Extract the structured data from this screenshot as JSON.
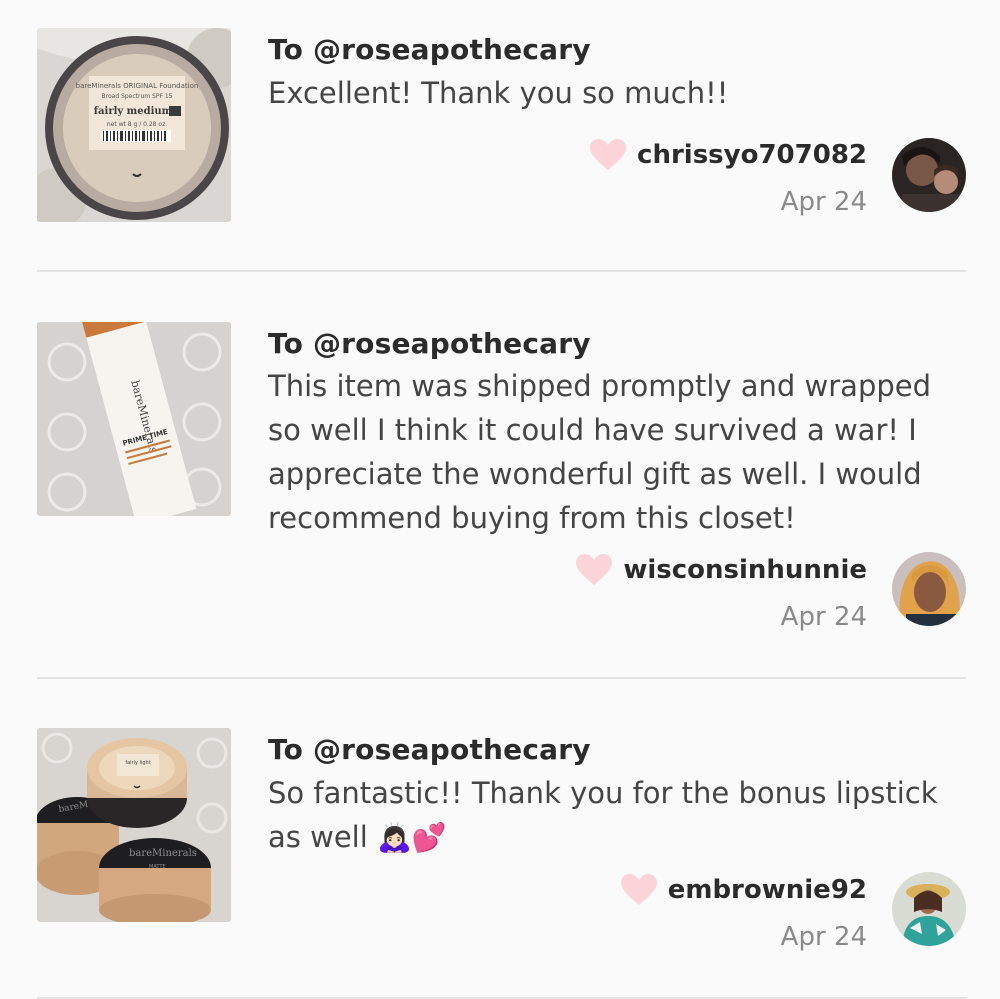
{
  "reviews": [
    {
      "recipient": "To @roseapothecary",
      "comment": "Excellent! Thank you so much!!",
      "username": "chrissyo707082",
      "date": "Apr 24",
      "thumb_label": "bareMinerals ORIGINAL Foundation Broad Spectrum SPF 15 fairly medium C20 net wt 8 g / 0.28 oz.",
      "thumb_brand": "bareMinerals",
      "thumb_shade": "fairly medium"
    },
    {
      "recipient": "To @roseapothecary",
      "comment": "This item was shipped promptly and wrapped so well I think it could have survived a war! I appreciate the wonderful gift as well. I would recommend buying from this closet!",
      "username": "wisconsinhunnie",
      "date": "Apr 24",
      "thumb_brand": "bareMinerals",
      "thumb_product": "PRIME TIME"
    },
    {
      "recipient": "To @roseapothecary",
      "comment": "So fantastic!! Thank you for the bonus lipstick as well",
      "comment_emoji": "🙇🏻‍♀️💕",
      "username": "embrownie92",
      "date": "Apr 24",
      "thumb_brand": "bareMinerals",
      "thumb_sub": "MATTE"
    }
  ],
  "icons": {
    "like": "heart-icon"
  },
  "colors": {
    "heart": "#fad4d9",
    "divider": "#e2e2e2",
    "text": "#454545",
    "muted": "#8a8a8a"
  }
}
